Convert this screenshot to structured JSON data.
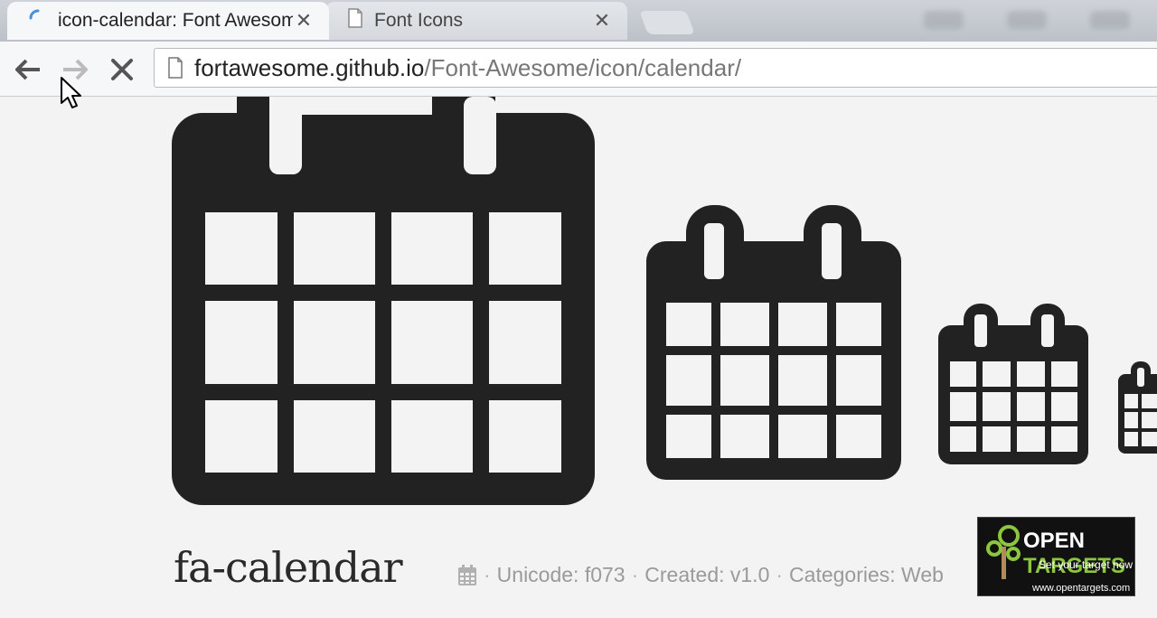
{
  "browser": {
    "tabs": [
      {
        "title": "icon-calendar: Font Awesome",
        "close": "✕",
        "active": true
      },
      {
        "title": "Font Icons",
        "close": "✕",
        "active": false
      }
    ],
    "url": {
      "host": "fortawesome.github.io",
      "path": "/Font-Awesome/icon/calendar/"
    }
  },
  "page": {
    "heading": "fa-calendar",
    "meta": {
      "unicode": "Unicode: f073",
      "created": "Created: v1.0",
      "categories": "Categories: Web"
    },
    "separator": "·"
  },
  "watermark": {
    "brand_white": "OPEN ",
    "brand_green": "TARGETS",
    "tagline": "Set your target now",
    "url": "www.opentargets.com"
  },
  "colors": {
    "icon": "#222222",
    "meta_text": "#9a9a9a",
    "watermark_green": "#8cc63f",
    "spinner": "#4a90d9"
  }
}
